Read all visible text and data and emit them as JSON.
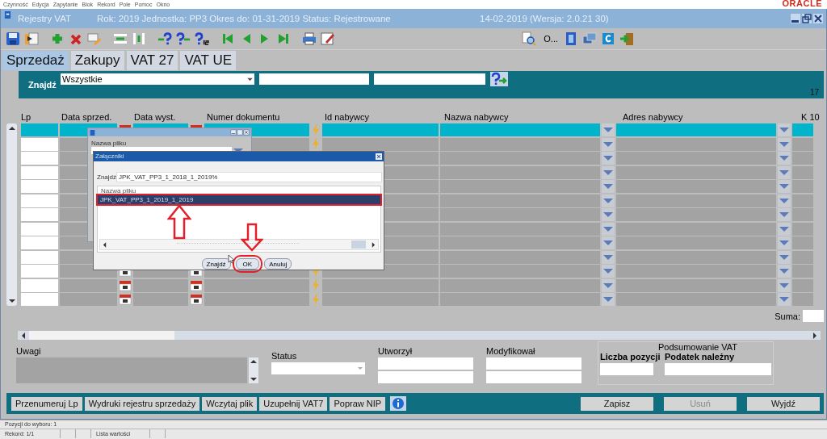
{
  "menu": [
    "Czynność",
    "Edycja",
    "Zapytanie",
    "Blok",
    "Rekord",
    "Pole",
    "Pomoc",
    "Okno"
  ],
  "logo": "ORACLE",
  "window": {
    "title": "Rejestry VAT",
    "info": "Rok: 2019 Jednostka: PP3 Okres do: 01-31-2019 Status: Rejestrowane",
    "version": "14-02-2019  (Wersja: 2.0.21 30)"
  },
  "toolbar": {
    "text_button": "O..."
  },
  "tabs": [
    {
      "label": "Sprzedaż",
      "selected": true
    },
    {
      "label": "Zakupy",
      "selected": false
    },
    {
      "label": "VAT 27",
      "selected": false
    },
    {
      "label": "VAT UE",
      "selected": false
    }
  ],
  "search": {
    "label": "Znajdź",
    "filter": "Wszystkie",
    "count": "17"
  },
  "grid": {
    "columns": [
      "Lp",
      "Data sprzed.",
      "Data wyst.",
      "Numer dokumentu",
      "Id nabywcy",
      "Nazwa nabywcy",
      "Adres nabywcy",
      "K 10"
    ],
    "rows": [
      {
        "selected": true
      },
      {
        "selected": false
      },
      {
        "selected": false
      },
      {
        "selected": false
      },
      {
        "selected": false
      },
      {
        "selected": false
      },
      {
        "selected": false
      },
      {
        "selected": false
      },
      {
        "selected": false
      },
      {
        "selected": false
      },
      {
        "selected": false
      },
      {
        "selected": false
      },
      {
        "selected": false
      }
    ],
    "sum_label": "Suma:"
  },
  "details": {
    "notes_label": "Uwagi",
    "status_label": "Status",
    "created_label": "Utworzył",
    "modified_label": "Modyfikował",
    "summary_title": "Podsumowanie VAT",
    "count_label": "Liczba pozycji",
    "tax_label": "Podatek należny"
  },
  "buttons_left": [
    "Przenumeruj Lp",
    "Wydruki rejestru sprzedaży",
    "Wczytaj plik",
    "Uzupełnij VAT7",
    "Popraw NIP"
  ],
  "buttons_right": [
    {
      "label": "Zapisz",
      "disabled": false
    },
    {
      "label": "Usuń",
      "disabled": true
    },
    {
      "label": "Wyjdź",
      "disabled": false
    }
  ],
  "status_bar": {
    "line1": "Pozycji do wyboru: 1",
    "record": "Rekord: 1/1",
    "mode": "Lista wartości"
  },
  "file_window": {
    "field_label": "Nazwa pliku"
  },
  "attachments": {
    "title": "Załączniki",
    "find_label": "Znajdź",
    "find_value": "JPK_VAT_PP3_1_2018_1_2019%",
    "list_header": "Nazwa pliku",
    "items": [
      {
        "name": "JPK_VAT_PP3_1_2019_1_2019",
        "selected": true
      }
    ],
    "buttons": [
      {
        "label": "Znajdź",
        "highlighted": false
      },
      {
        "label": "OK",
        "highlighted": true
      },
      {
        "label": "Anuluj",
        "highlighted": false
      }
    ]
  }
}
